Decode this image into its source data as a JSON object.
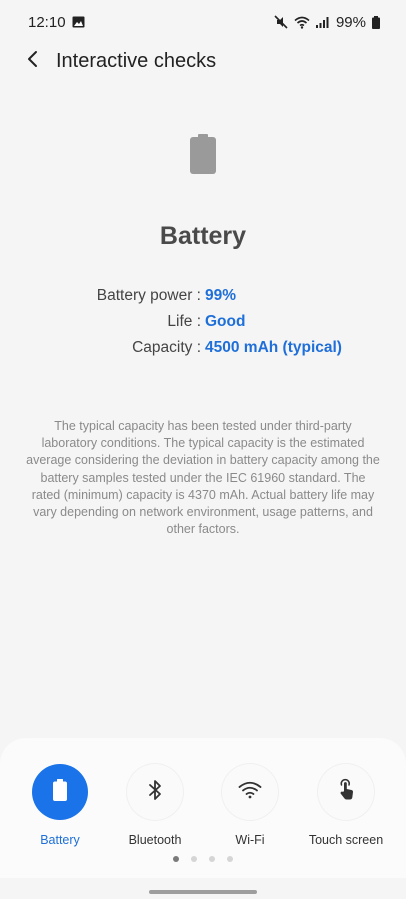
{
  "status_bar": {
    "time": "12:10",
    "battery_percent": "99%",
    "icons": [
      "image-icon",
      "mute-icon",
      "wifi-icon",
      "signal-icon",
      "battery-icon"
    ]
  },
  "header": {
    "back_icon": "chevron-left-icon",
    "title": "Interactive checks"
  },
  "main": {
    "icon": "battery-icon",
    "title": "Battery",
    "info": [
      {
        "label": "Battery power : ",
        "value": "99%"
      },
      {
        "label": "Life : ",
        "value": "Good"
      },
      {
        "label": "Capacity : ",
        "value": "4500 mAh (typical)"
      }
    ],
    "disclaimer": "The typical capacity has been tested under third-party laboratory conditions. The typical capacity is the estimated average considering the deviation in battery capacity among the battery samples tested under the IEC 61960 standard. The rated (minimum) capacity is 4370 mAh. Actual battery life may vary depending on network environment, usage patterns, and other factors."
  },
  "checks": [
    {
      "label": "Battery",
      "icon": "battery-icon",
      "active": true
    },
    {
      "label": "Bluetooth",
      "icon": "bluetooth-icon",
      "active": false
    },
    {
      "label": "Wi-Fi",
      "icon": "wifi-icon",
      "active": false
    },
    {
      "label": "Touch screen",
      "icon": "touch-icon",
      "active": false
    }
  ],
  "pagination": {
    "count": 4,
    "current": 1
  },
  "colors": {
    "accent": "#1a73e8",
    "value_text": "#1e6fd9",
    "background": "#f5f5f5"
  }
}
